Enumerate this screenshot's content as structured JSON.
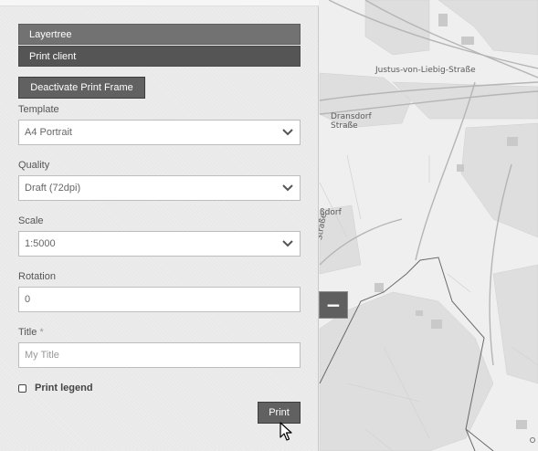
{
  "tabs": [
    {
      "label": "Layertree"
    },
    {
      "label": "Print client"
    }
  ],
  "print": {
    "deactivate_label": "Deactivate Print Frame",
    "template": {
      "label": "Template",
      "value": "A4 Portrait"
    },
    "quality": {
      "label": "Quality",
      "value": "Draft (72dpi)"
    },
    "scale": {
      "label": "Scale",
      "value": "1:5000"
    },
    "rotation": {
      "label": "Rotation",
      "value": "0"
    },
    "title": {
      "label": "Title",
      "required_mark": "*",
      "placeholder": "My Title"
    },
    "legend_label": "Print legend",
    "legend_checked": false,
    "print_label": "Print"
  },
  "map": {
    "labels": [
      "Justus-von-Liebig-Straße",
      "Dransdorf",
      "Straße",
      "ßdorf",
      "Straße"
    ],
    "zoom_out": "−"
  },
  "colors": {
    "tab_bg": "#727272",
    "tab_active_bg": "#555555",
    "button_bg": "#616161",
    "panel_bg": "#e9e9e9",
    "map_bg": "#efefef"
  },
  "icons": {
    "select_arrow": "chevron-down-icon",
    "checkbox": "checkbox-icon",
    "cursor": "mouse-pointer-icon"
  }
}
